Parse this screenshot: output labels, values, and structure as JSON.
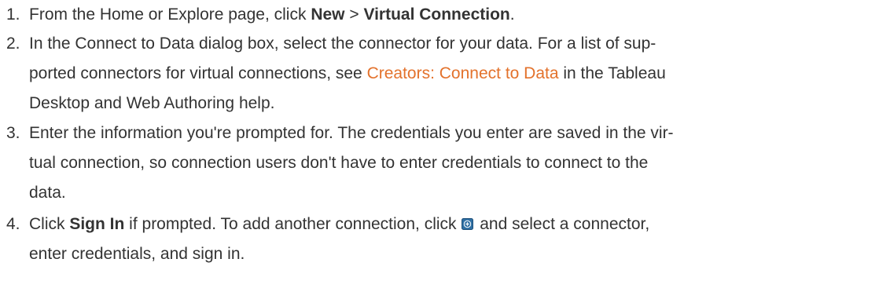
{
  "steps": [
    {
      "number": "1.",
      "lines": [
        {
          "t1": "From the Home or Explore page, click ",
          "b1": "New",
          "t2": " > ",
          "b2": "Virtual Connection",
          "t3": "."
        }
      ]
    },
    {
      "number": "2.",
      "lines": [
        {
          "text": "In the Connect to Data dialog box, select the connector for your data. For a list of sup-"
        },
        {
          "before": "ported connectors for virtual connections, see ",
          "link": "Creators: Connect to Data",
          "after": " in the Tableau"
        },
        {
          "text": "Desktop and Web Authoring help."
        }
      ]
    },
    {
      "number": "3.",
      "lines": [
        {
          "text": "Enter the information you're prompted for. The credentials you enter are saved in the vir-"
        },
        {
          "text": "tual connection, so connection users don't have to enter credentials to connect to the"
        },
        {
          "text": "data."
        }
      ]
    },
    {
      "number": "4.",
      "lines": [
        {
          "t1": "Click ",
          "b1": "Sign In",
          "t2": " if prompted. To add another connection, click ",
          "icon": "add-connection-icon",
          "t3": " and select a connector,"
        },
        {
          "text": "enter credentials, and sign in."
        }
      ]
    }
  ],
  "colors": {
    "text": "#333333",
    "link": "#e3722c",
    "icon_fill": "#2f6fa3",
    "icon_border": "#1d4f7a"
  }
}
